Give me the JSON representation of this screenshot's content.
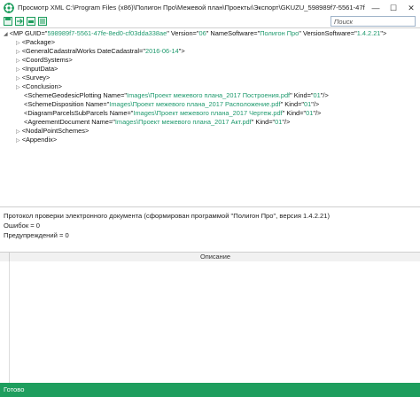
{
  "window": {
    "title": "Просмотр XML C:\\Program Files (x86)\\Полигон Про\\Межевой план\\Проекты\\Экспорт\\GKUZU_598989f7-5561-47fe-8ed0",
    "buttons": {
      "minimize": "—",
      "maximize": "☐",
      "close": "✕"
    },
    "accent_color": "#1e9e5e"
  },
  "toolbar": {
    "icons": [
      "save-icon",
      "export-icon",
      "print-icon",
      "view-icon"
    ],
    "search_placeholder": "Поиск"
  },
  "tree": {
    "root": {
      "open": "<MP GUID=\"",
      "guid": "598989f7-5561-47fe-8ed0-cf03dda338ae",
      "mid1": "\" Version=\"",
      "version": "06",
      "mid2": "\" NameSoftware=\"",
      "software": "Полигон Про",
      "mid3": "\" VersionSoftware=\"",
      "swversion": "1.4.2.21",
      "close": "\">"
    },
    "lines": [
      {
        "tag": "<Package>",
        "expanded": false
      },
      {
        "tag": "<GeneralCadastralWorks DateCadastral=\"",
        "value": "2016-06-14",
        "end": "\">",
        "expanded": false
      },
      {
        "tag": "<CoordSystems>",
        "expanded": false
      },
      {
        "tag": "<InputData>",
        "expanded": false
      },
      {
        "tag": "<Survey>",
        "expanded": false
      },
      {
        "tag": "<Conclusion>",
        "expanded": false
      },
      {
        "tag": "<SchemeGeodesicPlotting Name=\"",
        "value": "Images\\Проект межевого плана_2017 Построения.pdf",
        "mid": "\" Kind=\"",
        "kind": "01",
        "end": "\"/>"
      },
      {
        "tag": "<SchemeDisposition Name=\"",
        "value": "Images\\Проект межевого плана_2017 Расположение.pdf",
        "mid": "\" Kind=\"",
        "kind": "01",
        "end": "\"/>"
      },
      {
        "tag": "<DiagramParcelsSubParcels Name=\"",
        "value": "Images\\Проект межевого плана_2017 Чертеж.pdf",
        "mid": "\" Kind=\"",
        "kind": "01",
        "end": "\"/>"
      },
      {
        "tag": "<AgreementDocument Name=\"",
        "value": "Images\\Проект межевого плана_2017 Акт.pdf",
        "mid": "\" Kind=\"",
        "kind": "01",
        "end": "\"/>"
      },
      {
        "tag": "<NodalPointSchemes>",
        "expanded": false
      },
      {
        "tag": "<Appendix>",
        "expanded": false
      }
    ]
  },
  "protocol": {
    "line1": "Протокол проверки электронного документа (сформирован программой \"Полигон Про\", версия 1.4.2.21)",
    "errors": "Ошибок = 0",
    "warnings": "Предупреждений = 0"
  },
  "grid": {
    "column_header": "Описание"
  },
  "status": {
    "text": "Готово"
  }
}
